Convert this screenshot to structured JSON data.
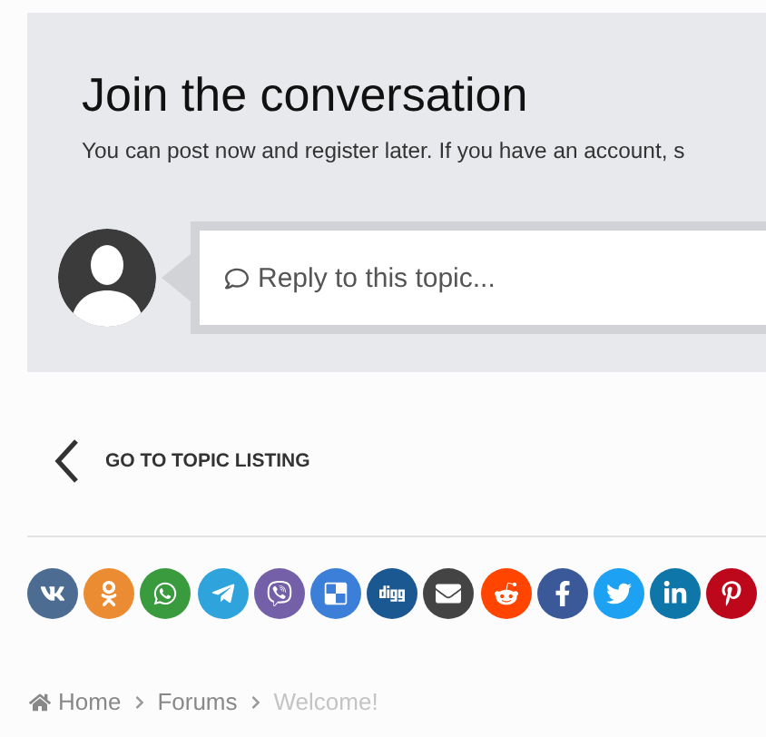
{
  "reply_panel": {
    "title": "Join the conversation",
    "subtitle": "You can post now and register later. If you have an account, s",
    "reply_placeholder": "Reply to this topic..."
  },
  "back_link": {
    "label": "GO TO TOPIC LISTING"
  },
  "share_buttons": [
    {
      "kind": "vk",
      "color": "#4c6c91"
    },
    {
      "kind": "odnoklassniki",
      "color": "#eb8c33"
    },
    {
      "kind": "whatsapp",
      "color": "#3a9a3e"
    },
    {
      "kind": "telegram",
      "color": "#2fa3dc"
    },
    {
      "kind": "viber",
      "color": "#7360a8"
    },
    {
      "kind": "delicious",
      "color": "#3c7fd8"
    },
    {
      "kind": "digg",
      "color": "#1b5891"
    },
    {
      "kind": "email",
      "color": "#444444"
    },
    {
      "kind": "reddit",
      "color": "#ff4500"
    },
    {
      "kind": "facebook",
      "color": "#3b5998"
    },
    {
      "kind": "twitter",
      "color": "#1da1f2"
    },
    {
      "kind": "linkedin",
      "color": "#0e76a8"
    },
    {
      "kind": "pinterest",
      "color": "#bd081c"
    }
  ],
  "breadcrumb": [
    {
      "label": "Home",
      "current": false
    },
    {
      "label": "Forums",
      "current": false
    },
    {
      "label": "Welcome!",
      "current": true
    }
  ]
}
